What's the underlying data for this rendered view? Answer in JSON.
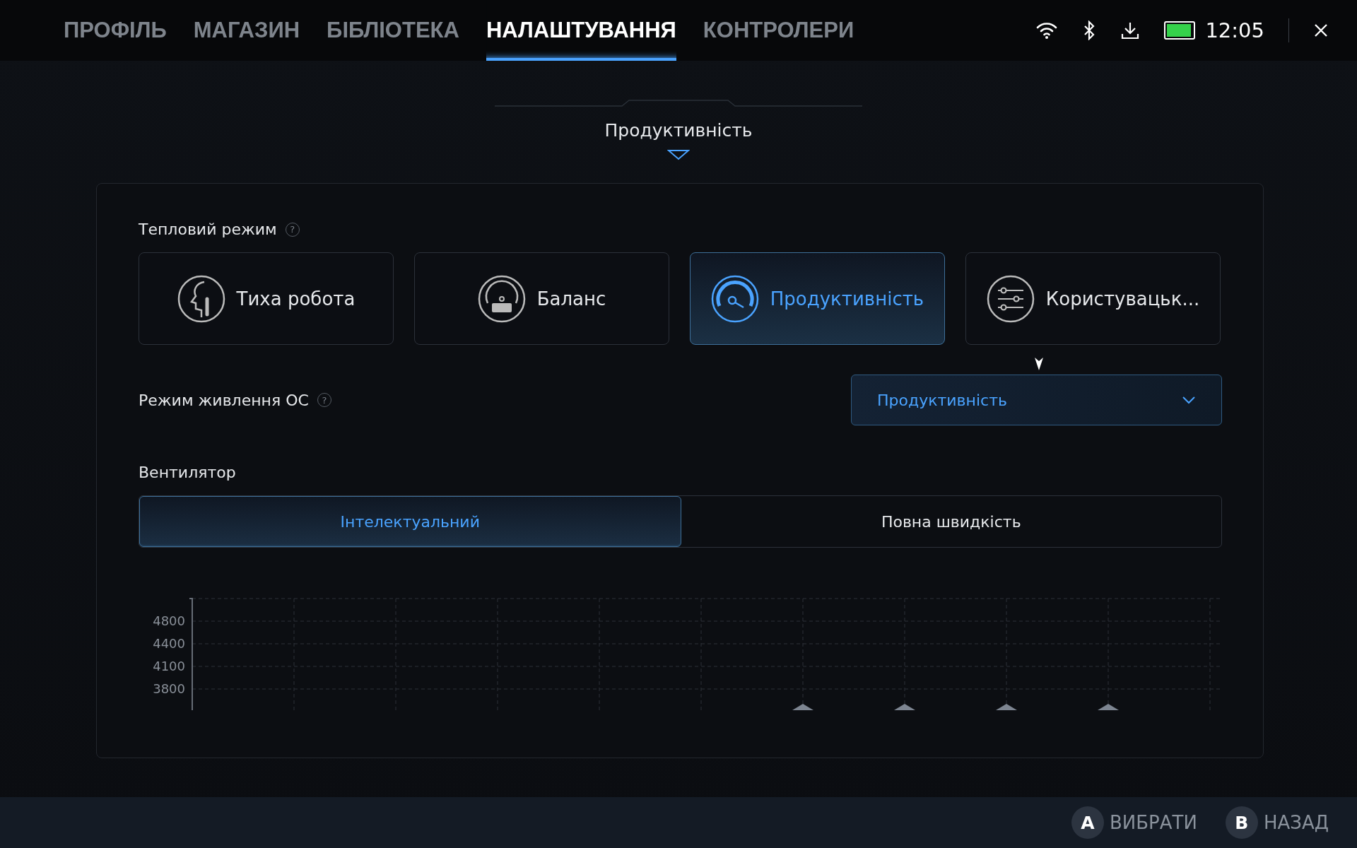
{
  "tabs": [
    {
      "label": "ПРОФІЛЬ",
      "selected": false
    },
    {
      "label": "МАГАЗИН",
      "selected": false
    },
    {
      "label": "БІБЛІОТЕКА",
      "selected": false
    },
    {
      "label": "НАЛАШТУВАННЯ",
      "selected": true
    },
    {
      "label": "КОНТРОЛЕРИ",
      "selected": false
    }
  ],
  "status": {
    "time": "12:05"
  },
  "section_title": "Продуктивність",
  "thermal": {
    "label": "Тепловий режим",
    "help": "?",
    "modes": [
      {
        "kind": "quiet",
        "label": "Тиха робота",
        "selected": false
      },
      {
        "kind": "balance",
        "label": "Баланс",
        "selected": false
      },
      {
        "kind": "performance",
        "label": "Продуктивність",
        "selected": true
      },
      {
        "kind": "custom",
        "label": "Користувацьк...",
        "selected": false
      }
    ]
  },
  "power_mode": {
    "label": "Режим живлення ОС",
    "help": "?",
    "value": "Продуктивність"
  },
  "fan": {
    "label": "Вентилятор",
    "options": [
      {
        "label": "Інтелектуальний",
        "selected": true
      },
      {
        "label": "Повна швидкість",
        "selected": false
      }
    ],
    "curve_y_labels": [
      "4800",
      "4400",
      "4100",
      "3800"
    ]
  },
  "footer": [
    {
      "key": "A",
      "label": "ВИБРАТИ"
    },
    {
      "key": "B",
      "label": "НАЗАД"
    }
  ]
}
